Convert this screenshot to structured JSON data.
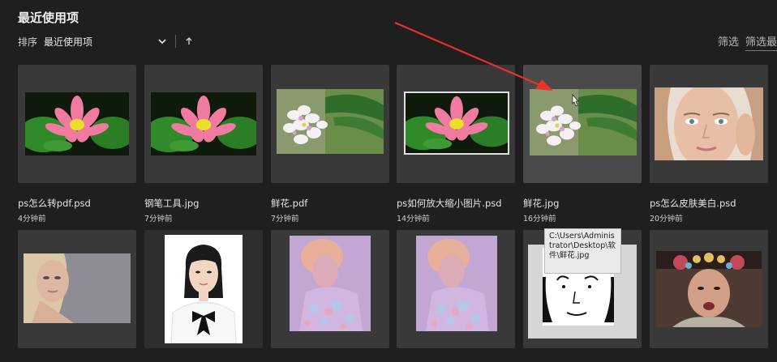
{
  "header": {
    "title": "最近使用项"
  },
  "sort": {
    "label": "排序",
    "value": "最近使用项"
  },
  "filter": {
    "label": "筛选",
    "label_underlined": "筛选最"
  },
  "files": [
    {
      "name": "ps怎么转pdf.psd",
      "time": "4分钟前"
    },
    {
      "name": "钢笔工具.jpg",
      "time": "7分钟前"
    },
    {
      "name": "鲜花.pdf",
      "time": "7分钟前"
    },
    {
      "name": "ps如何放大缩小图片.psd",
      "time": "14分钟前"
    },
    {
      "name": "鲜花.jpg",
      "time": "16分钟前"
    },
    {
      "name": "ps怎么皮肤美白.psd",
      "time": "20分钟前"
    }
  ],
  "tooltip": {
    "text": "C:\\Users\\Administrator\\Desktop\\软件\\鲜花.jpg"
  },
  "colors": {
    "background": "#1f1f1f",
    "card": "#393939",
    "annotation_arrow": "#e8322b"
  }
}
